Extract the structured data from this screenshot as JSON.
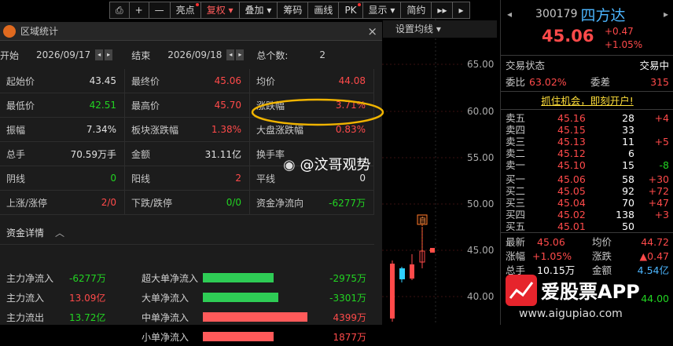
{
  "toolbar": {
    "items": [
      "",
      "+",
      "—",
      "亮点",
      "复权",
      "叠加",
      "筹码",
      "画线",
      "PK",
      "显示",
      "简约",
      "▸▸",
      "▸"
    ]
  },
  "chart": {
    "settings_label": "设置均线",
    "price_labels": [
      "65.00",
      "60.00",
      "55.00",
      "50.00",
      "45.00",
      "40.00"
    ],
    "marker_label": "自"
  },
  "dialog": {
    "title": "区域统计",
    "close": "×",
    "start_label": "开始",
    "start_date": "2026/09/17",
    "end_label": "结束",
    "end_date": "2026/09/18",
    "count_label": "总个数:",
    "count_value": "2",
    "stats": [
      [
        [
          "起始价",
          "43.45",
          "white"
        ],
        [
          "最终价",
          "45.06",
          "red"
        ],
        [
          "均价",
          "44.08",
          "red"
        ]
      ],
      [
        [
          "最低价",
          "42.51",
          "green"
        ],
        [
          "最高价",
          "45.70",
          "red"
        ],
        [
          "涨跌幅",
          "3.71%",
          "red"
        ]
      ],
      [
        [
          "振幅",
          "7.34%",
          "white"
        ],
        [
          "板块涨跌幅",
          "1.38%",
          "red"
        ],
        [
          "大盘涨跌幅",
          "0.83%",
          "red"
        ]
      ],
      [
        [
          "总手",
          "70.59万手",
          "white"
        ],
        [
          "金额",
          "31.11亿",
          "white"
        ],
        [
          "换手率",
          "",
          ""
        ]
      ],
      [
        [
          "阴线",
          "0",
          "green"
        ],
        [
          "阳线",
          "2",
          "red"
        ],
        [
          "平线",
          "0",
          "white"
        ]
      ],
      [
        [
          "上涨/涨停",
          "2/0",
          "red"
        ],
        [
          "下跌/跌停",
          "0/0",
          "green"
        ],
        [
          "资金净流向",
          "-6277万",
          "green"
        ]
      ]
    ],
    "capital_title": "资金详情",
    "flows": [
      {
        "label": "主力净流入",
        "value": "-6277万",
        "vcolor": "green",
        "label2": "超大单净流入",
        "bar": 0.62,
        "barcolor": "#2ecc55",
        "value2": "-2975万",
        "v2color": "green"
      },
      {
        "label": "主力流入",
        "value": "13.09亿",
        "vcolor": "red",
        "label2": "大单净流入",
        "bar": 0.66,
        "barcolor": "#2ecc55",
        "value2": "-3301万",
        "v2color": "green"
      },
      {
        "label": "主力流出",
        "value": "13.72亿",
        "vcolor": "green",
        "label2": "中单净流入",
        "bar": 0.92,
        "barcolor": "#ff5a5a",
        "value2": "4399万",
        "v2color": "red"
      },
      {
        "label": "",
        "value": "",
        "vcolor": "white",
        "label2": "小单净流入",
        "bar": 0.62,
        "barcolor": "#ff5a5a",
        "value2": "1877万",
        "v2color": "red"
      }
    ]
  },
  "quote": {
    "code": "300179",
    "name": "四方达",
    "price": "45.06",
    "change": "+0.47",
    "change_pct": "+1.05%",
    "status_label": "交易状态",
    "status_value": "交易中",
    "weibi_label": "委比",
    "weibi_value": "63.02%",
    "weicha_label": "委差",
    "weicha_value": "315",
    "promo": "抓住机会，即刻开户!",
    "asks": [
      [
        "卖五",
        "45.16",
        "28",
        "+4"
      ],
      [
        "卖四",
        "45.15",
        "33",
        ""
      ],
      [
        "卖三",
        "45.13",
        "11",
        "+5"
      ],
      [
        "卖二",
        "45.12",
        "6",
        ""
      ],
      [
        "卖一",
        "45.10",
        "15",
        "-8"
      ]
    ],
    "bids": [
      [
        "买一",
        "45.06",
        "58",
        "+30"
      ],
      [
        "买二",
        "45.05",
        "92",
        "+72"
      ],
      [
        "买三",
        "45.04",
        "70",
        "+47"
      ],
      [
        "买四",
        "45.02",
        "138",
        "+3"
      ],
      [
        "买五",
        "45.01",
        "50",
        ""
      ]
    ],
    "latest_label": "最新",
    "latest_value": "45.06",
    "avg_label": "均价",
    "avg_value": "44.72",
    "pct_label": "涨幅",
    "pct_value": "+1.05%",
    "diff_label": "涨跌",
    "diff_value": "▲0.47",
    "vol_label": "总手",
    "vol_value": "10.15万",
    "amt_label": "金额",
    "amt_value": "4.54亿",
    "extra_value": "44.00"
  },
  "watermarks": {
    "weibo": "@汶哥观势",
    "app": "爱股票APP",
    "url": "www.aigupiao.com"
  },
  "colors": {
    "up": "#ff4a4a",
    "down": "#22d422",
    "accent": "#4cb6ff",
    "highlight": "#f0b400"
  }
}
